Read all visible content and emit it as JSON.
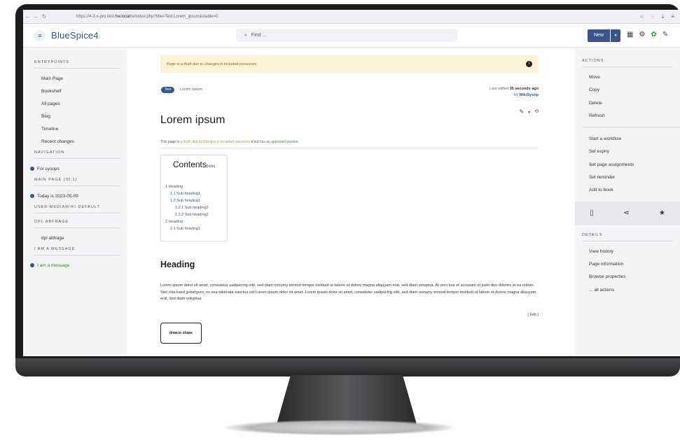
{
  "browser": {
    "url_prefix": "https://4-3-x-pro.test.",
    "url_domain": "hw.local",
    "url_suffix": "/w/index.php?title=Test:Lorem_ipsum&stable=0",
    "back_icon": "arrow-left-icon",
    "forward_icon": "arrow-right-icon",
    "reload_icon": "reload-icon"
  },
  "header": {
    "logo": "BlueSpice4",
    "search_placeholder": "Find ...",
    "new_label": "New",
    "accent": "#3e5389"
  },
  "left_sidebar": {
    "entrypoints_title": "ENTRYPOINTS",
    "entrypoints": [
      "Main Page",
      "Bookshelf",
      "All pages",
      "Blog",
      "Timeline",
      "Recent changes"
    ],
    "navigation_title": "NAVIGATION",
    "navigation_item": "For sysops",
    "mainpage_title": "MAIN PAGE (ID:1)",
    "mainpage_item": "Today is 2023-05-09",
    "usermw_title": "USER:MEDIAWIKI DEFAULT",
    "dpl_title": "DPL ABFRAGE",
    "dpl_item": "dpl abfrage",
    "message_title": "I AM A MESSAGE",
    "message_item": "I am a message"
  },
  "main": {
    "notice": "Page is a draft due to changes in included resources",
    "tag": "Test",
    "tag_text": "Lorem ipsum",
    "last_edited_prefix": "Last edited",
    "last_edited_time": "35 seconds ago",
    "last_edited_by_prefix": "by",
    "last_edited_user": "WikiSysop",
    "title": "Lorem ipsum",
    "status_prefix": "This page is",
    "status_draft": "a draft, due to changes in included resources",
    "status_mid": "▾ but",
    "status_approved": "has an approved version",
    "toc_title": "Contents",
    "toc_hide": "[hide]",
    "toc_entries": [
      {
        "level": 1,
        "text": "1 Heading"
      },
      {
        "level": 2,
        "text": "1.1 Sub heading1"
      },
      {
        "level": 2,
        "text": "1.2 Sub heading1"
      },
      {
        "level": 3,
        "text": "1.2.1 Sub heading2"
      },
      {
        "level": 3,
        "text": "1.2.2 Sub heading2"
      },
      {
        "level": 1,
        "text": "2 Heading"
      },
      {
        "level": 2,
        "text": "2.1 Sub heading1"
      }
    ],
    "heading": "Heading",
    "body": "Lorem ipsum dolor sit amet, consetetur sadipscing elitr, sed diam nonumy eirmod tempor invidunt ut labore et dolore magna aliquyam erat, sed diam voluptua. At vero eos et accusam et justo duo dolores et ea rebum. Stet clita kasd gubergren, no sea takimata sanctus est Lorem ipsum dolor sit amet. Lorem ipsum dolor sit amet, consetetur sadipscing elitr, sed diam nonumy eirmod tempor invidunt ut labore et dolore magna aliquyam erat, sed diam voluptua.",
    "edit_link": "[ Edit ]",
    "drawio_label": "draw.io shape"
  },
  "right_sidebar": {
    "actions_title": "ACTIONS",
    "actions": [
      "Move",
      "Copy",
      "Delete",
      "Refresh"
    ],
    "workflow_actions": [
      "Start a workflow",
      "Set expiry",
      "Set page assignments",
      "Set reminder",
      "Add to book"
    ],
    "details_title": "DETAILS",
    "details": [
      "View history",
      "Page information",
      "Browse properties",
      "... all actions"
    ]
  }
}
